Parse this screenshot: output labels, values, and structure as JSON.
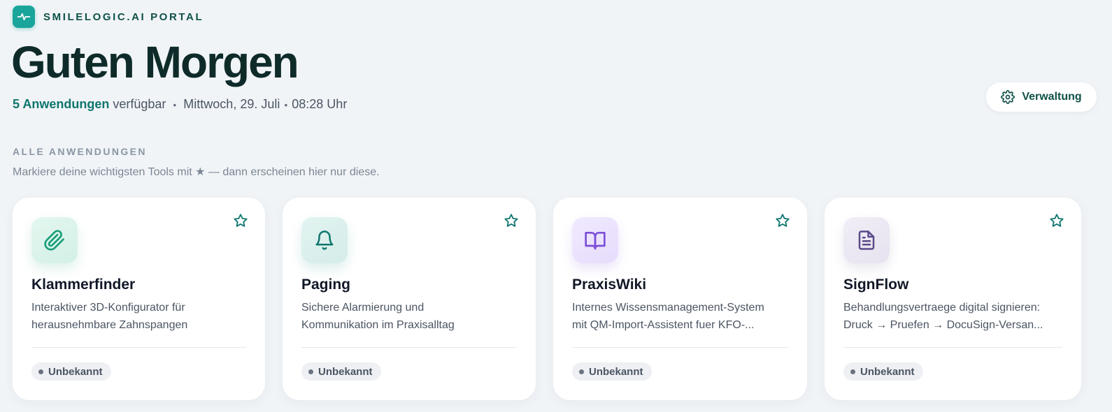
{
  "brand": {
    "name": "SMILELOGIC.AI PORTAL",
    "icon": "pulse-icon",
    "accent": "#1aa59b"
  },
  "header": {
    "greeting_part1": "Guten ",
    "greeting_part2": "Morgen",
    "app_count": "5 Anwendungen",
    "available_label": "verfügbar",
    "date": "Mittwoch, 29. Juli",
    "time": "08:28 Uhr"
  },
  "admin_button": {
    "label": "Verwaltung",
    "icon": "gear-icon"
  },
  "section": {
    "title": "ALLE ANWENDUNGEN",
    "hint": "Markiere deine wichtigsten Tools mit ★ — dann erscheinen hier nur diese."
  },
  "apps": [
    {
      "name": "Klammerfinder",
      "desc_line1": "Interaktiver 3D-Konfigurator für",
      "desc_line2": "herausnehmbare Zahnspangen",
      "status": "Unbekannt",
      "icon": "paperclip-icon",
      "color": "#1a9e7a"
    },
    {
      "name": "Paging",
      "desc_line1": "Sichere Alarmierung und",
      "desc_line2": "Kommunikation im Praxisalltag",
      "status": "Unbekannt",
      "icon": "bell-icon",
      "color": "#0f766e"
    },
    {
      "name": "PraxisWiki",
      "desc_line1": "Internes Wissensmanagement-System",
      "desc_line2": "mit QM-Import-Assistent fuer KFO-...",
      "status": "Unbekannt",
      "icon": "book-icon",
      "color": "#7c4fd6"
    },
    {
      "name": "SignFlow",
      "desc_line1": "Behandlungsvertraege digital signieren:",
      "desc_line2": "Druck → Pruefen → DocuSign-Versan...",
      "status": "Unbekannt",
      "icon": "document-icon",
      "color": "#5b4a8a"
    }
  ]
}
